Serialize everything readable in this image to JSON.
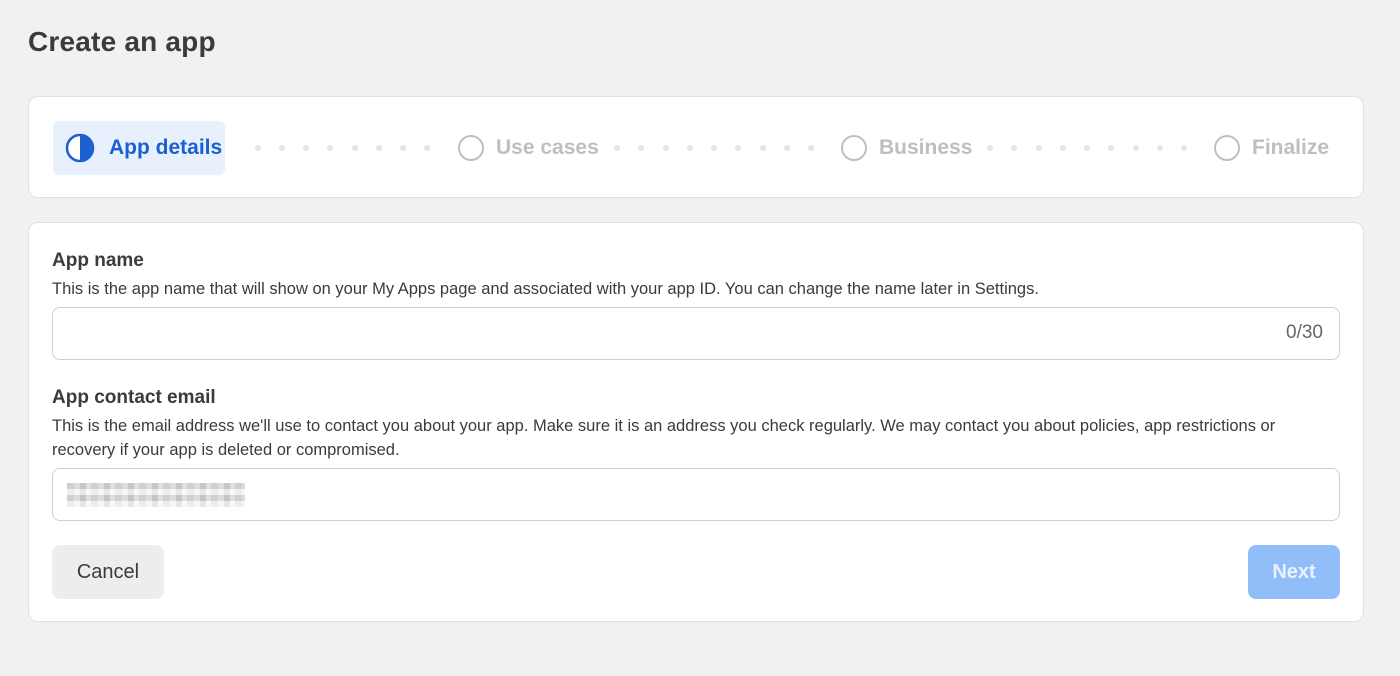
{
  "page": {
    "title": "Create an app"
  },
  "stepper": {
    "steps": [
      {
        "label": "App details",
        "state": "active",
        "icon": "half-circle-icon"
      },
      {
        "label": "Use cases",
        "state": "pending",
        "icon": "circle-icon"
      },
      {
        "label": "Business",
        "state": "pending",
        "icon": "circle-icon"
      },
      {
        "label": "Finalize",
        "state": "pending",
        "icon": "circle-icon"
      }
    ],
    "active_color": "#1b5fd1",
    "active_bg": "#e7f0fc",
    "inactive_color": "#bcc0c4"
  },
  "form": {
    "app_name": {
      "label": "App name",
      "description": "This is the app name that will show on your My Apps page and associated with your app ID. You can change the name later in Settings.",
      "value": "",
      "counter": "0/30"
    },
    "contact_email": {
      "label": "App contact email",
      "description": "This is the email address we'll use to contact you about your app. Make sure it is an address you check regularly. We may contact you about policies, app restrictions or recovery if your app is deleted or compromised.",
      "value_redacted": true
    }
  },
  "actions": {
    "cancel_label": "Cancel",
    "next_label": "Next",
    "next_enabled": false,
    "next_color": "#91bdf9"
  }
}
